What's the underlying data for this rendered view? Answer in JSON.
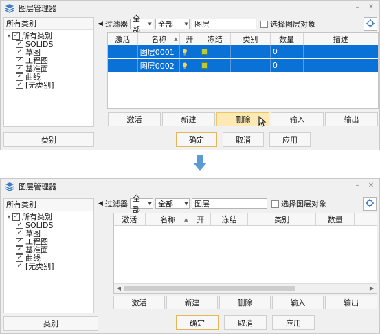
{
  "window": {
    "title": "图层管理器",
    "minimize": "–",
    "close": "✕"
  },
  "left_panel": {
    "header": "所有类别",
    "tree": [
      {
        "label": "所有类别",
        "checked": true,
        "root": true
      },
      {
        "label": "SOLIDS",
        "checked": true
      },
      {
        "label": "草图",
        "checked": true
      },
      {
        "label": "工程图",
        "checked": true
      },
      {
        "label": "基准面",
        "checked": true
      },
      {
        "label": "曲线",
        "checked": true
      },
      {
        "label": "[无类别]",
        "checked": true
      }
    ]
  },
  "category_button": "类别",
  "filter": {
    "label": "过滤器",
    "scope_value": "全部",
    "type_value": "全部",
    "search_value": "图层",
    "select_objects_label": "选择图层对象"
  },
  "top_columns": [
    "激活",
    "名称",
    "开",
    "冻结",
    "类别",
    "数量",
    "描述"
  ],
  "bottom_columns": [
    "激活",
    "名称",
    "开",
    "冻结",
    "类别",
    "数量"
  ],
  "rows": [
    {
      "active": "",
      "name": "图层0001",
      "on": "💡",
      "frozen": "",
      "category": "",
      "count": "0",
      "description": ""
    },
    {
      "active": "",
      "name": "图层0002",
      "on": "💡",
      "frozen": "",
      "category": "",
      "count": "0",
      "description": ""
    }
  ],
  "actions": {
    "activate": "激活",
    "new": "新建",
    "delete": "删除",
    "import": "输入",
    "export": "输出"
  },
  "dialog": {
    "ok": "确定",
    "cancel": "取消",
    "apply": "应用"
  },
  "colors": {
    "selection": "#0a72d6",
    "hover": "#fde9b3",
    "arrow": "#5b9bd5"
  }
}
